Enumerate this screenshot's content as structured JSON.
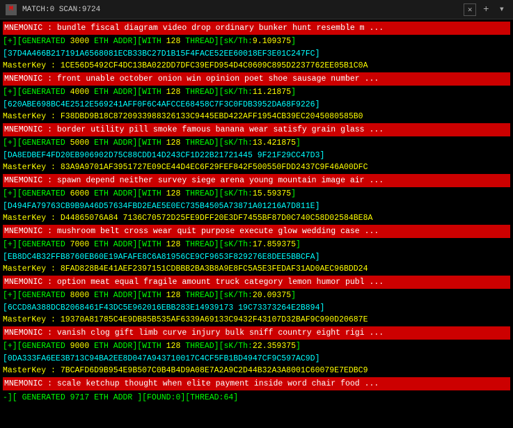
{
  "titleBar": {
    "icon": "M",
    "title": "MATCH:0 SCAN:9724",
    "closeLabel": "✕",
    "plusLabel": "+",
    "dropdownLabel": "▾"
  },
  "rows": [
    {
      "type": "mnemonic",
      "text": "MNEMONIC : bundle fiscal diagram video drop ordinary bunker hunt resemble m ..."
    },
    {
      "type": "generated",
      "text": "[+][GENERATED 3000 ETH ADDR][WITH 128 THREAD][sK/Th:9.109375]"
    },
    {
      "type": "addr",
      "text": "[37D4A466B217191A6568081ECB33BC27D1B15F4FACE52EE60018EF3E01C247FC]"
    },
    {
      "type": "masterkey",
      "text": "MasterKey : 1CE56D5492CF4DC13BA022DD7DFC39EFD954D4C0609C895D2237762EE05B1C0A"
    },
    {
      "type": "mnemonic",
      "text": "MNEMONIC : front unable october onion win opinion poet shoe sausage number ..."
    },
    {
      "type": "generated",
      "text": "[+][GENERATED 4000 ETH ADDR][WITH 128 THREAD][sK/Th:11.21875]"
    },
    {
      "type": "addr",
      "text": "[620ABE698BC4E2512E569241AFF0F6C4AFCCE68458C7F3C0FDB3952DA68F9226]"
    },
    {
      "type": "masterkey",
      "text": "MasterKey : F38DBD9B18C8720933988326133C9445EBD422AFF1954CB39EC2045080585B0"
    },
    {
      "type": "mnemonic",
      "text": "MNEMONIC : border utility pill smoke famous banana wear satisfy grain glass ..."
    },
    {
      "type": "generated",
      "text": "[+][GENERATED 5000 ETH ADDR][WITH 128 THREAD][sK/Th:13.421875]"
    },
    {
      "type": "addr",
      "text": "[DA8EDBEF4FD20EB906902D75C88CDD14D243CF1D22B21721445 9F21F29CC47D3]"
    },
    {
      "type": "masterkey",
      "text": "MasterKey : 83A9A9701AF3951727E09CE44D4EC6F29FEF842F500550FDD2437C9F46A00DFC"
    },
    {
      "type": "mnemonic",
      "text": "MNEMONIC : spawn depend neither survey siege arena young mountain image air ..."
    },
    {
      "type": "generated",
      "text": "[+][GENERATED 6000 ETH ADDR][WITH 128 THREAD][sK/Th:15.59375]"
    },
    {
      "type": "addr",
      "text": "[D494FA79763CB9B9A46D57634FBD2EAE5E0EC735B4505A73871A01216A7D811E]"
    },
    {
      "type": "masterkey",
      "text": "MasterKey : D44865076A84 7136C70572D25FE9DFF20E3DF7455BF87D0C740C58D02584BE8A"
    },
    {
      "type": "mnemonic",
      "text": "MNEMONIC : mushroom belt cross wear quit purpose execute glow wedding case ..."
    },
    {
      "type": "generated",
      "text": "[+][GENERATED 7000 ETH ADDR][WITH 128 THREAD][sK/Th:17.859375]"
    },
    {
      "type": "addr",
      "text": "[EB8DC4B32FFB8760EB60E19AFAFE8C6A81956CE9CF9653F829276E8DEE5BBCFA]"
    },
    {
      "type": "masterkey",
      "text": "MasterKey : 8FAD828B4E41AEF2397151CDBBB2BA3B8A9E8FC5A5E3FEDAF31AD0AEC96BDD24"
    },
    {
      "type": "mnemonic",
      "text": "MNEMONIC : option meat equal fragile amount truck category lemon humor publ ..."
    },
    {
      "type": "generated",
      "text": "[+][GENERATED 8000 ETH ADDR][WITH 128 THREAD][sK/Th:20.09375]"
    },
    {
      "type": "addr",
      "text": "[6CCD8A388DCB2068461F43DC5E962016EBB283E14939173 19C73373264E2B894]"
    },
    {
      "type": "masterkey",
      "text": "MasterKey : 19370A81785C4E9DB85B535AF6339A69133C9432F43107D32BAF9C990D20687E"
    },
    {
      "type": "mnemonic",
      "text": "MNEMONIC : vanish clog gift limb curve injury bulk sniff country eight rigi ..."
    },
    {
      "type": "generated",
      "text": "[+][GENERATED 9000 ETH ADDR][WITH 128 THREAD][sK/Th:22.359375]"
    },
    {
      "type": "addr",
      "text": "[0DA333FA6EE3B713C94BA2EE8D047A943710017C4CF5FB1BD4947CF9C597AC9D]"
    },
    {
      "type": "masterkey",
      "text": "MasterKey : 7BCAFD6D9B954E9B507C0B4B4D9A08E7A2A9C2D44B32A3A8001C60079E7EDBC9"
    },
    {
      "type": "mnemonic",
      "text": "MNEMONIC : scale ketchup thought when elite payment inside word chair food ..."
    },
    {
      "type": "status",
      "text": "-][ GENERATED 9717 ETH ADDR ][FOUND:0][THREAD:64]"
    }
  ],
  "colors": {
    "mnemonic_bg": "#cc0000",
    "mnemonic_fg": "#ffffff",
    "generated_fg": "#00ff00",
    "addr_fg": "#00ffff",
    "masterkey_fg": "#ffff00",
    "status_fg": "#00ff00",
    "background": "#000000"
  }
}
